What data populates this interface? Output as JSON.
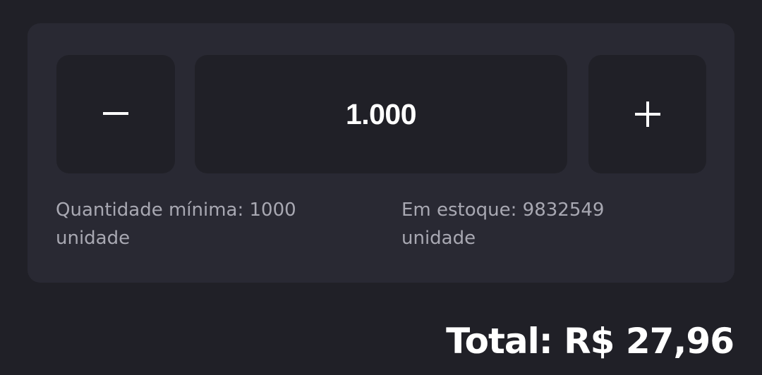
{
  "quantity_selector": {
    "minus_icon": "minus-icon",
    "plus_icon": "plus-icon",
    "quantity_value": "1.000",
    "min_quantity_label": "Quantidade mínima: 1000",
    "min_quantity_unit": "unidade",
    "stock_label": "Em estoque: 9832549",
    "stock_unit": "unidade"
  },
  "summary": {
    "total_label": "Total: R$ 27,96"
  },
  "colors": {
    "background": "#202027",
    "card": "#292933",
    "text_primary": "#ffffff",
    "text_secondary": "#a8a8b2"
  }
}
